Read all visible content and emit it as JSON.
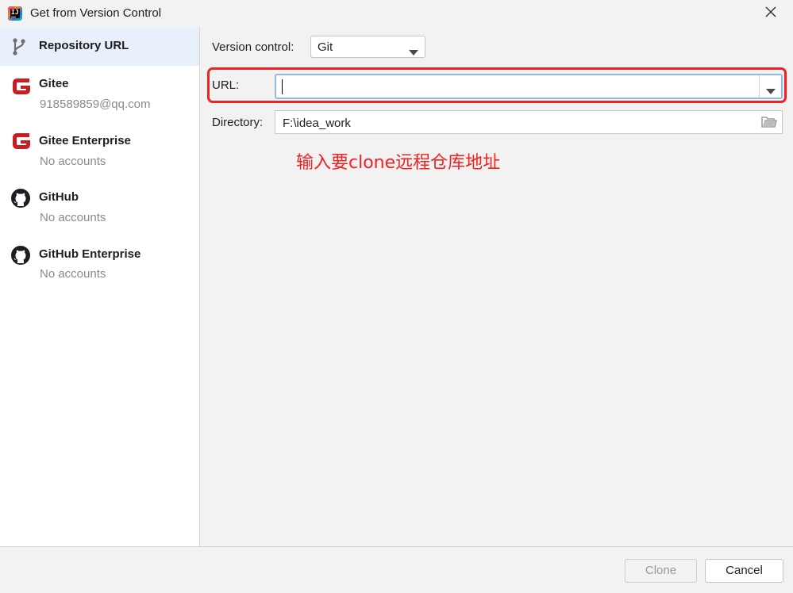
{
  "window": {
    "title": "Get from Version Control"
  },
  "sidebar": {
    "items": [
      {
        "name": "Repository URL",
        "sub": "",
        "icon": "branch-icon"
      },
      {
        "name": "Gitee",
        "sub": "918589859@qq.com",
        "icon": "gitee-icon"
      },
      {
        "name": "Gitee Enterprise",
        "sub": "No accounts",
        "icon": "gitee-icon"
      },
      {
        "name": "GitHub",
        "sub": "No accounts",
        "icon": "github-icon"
      },
      {
        "name": "GitHub Enterprise",
        "sub": "No accounts",
        "icon": "github-icon"
      }
    ]
  },
  "form": {
    "vc_label": "Version control:",
    "vc_value": "Git",
    "url_label": "URL:",
    "url_value": "",
    "dir_label": "Directory:",
    "dir_value": "F:\\idea_work"
  },
  "annotation": "输入要clone远程仓库地址",
  "footer": {
    "clone": "Clone",
    "cancel": "Cancel"
  },
  "colors": {
    "accent_red": "#f42020",
    "gitee_red": "#c71d23",
    "selection": "#e8f0fc"
  }
}
